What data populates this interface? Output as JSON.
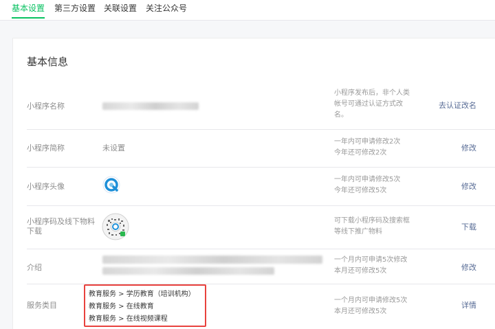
{
  "nav": {
    "tabs": [
      "基本设置",
      "第三方设置",
      "关联设置",
      "关注公众号"
    ],
    "active_index": 0
  },
  "section_title": "基本信息",
  "rows": {
    "name": {
      "label": "小程序名称",
      "note": [
        "小程序发布后，非个人类",
        "帐号可通过认证方式改",
        "名。"
      ],
      "action": "去认证改名"
    },
    "short_name": {
      "label": "小程序简称",
      "value": "未设置",
      "note": [
        "一年内可申请修改2次",
        "今年还可修改2次"
      ],
      "action": "修改"
    },
    "avatar": {
      "label": "小程序头像",
      "note": [
        "一年内可申请修改5次",
        "今年还可修改5次"
      ],
      "action": "修改"
    },
    "qrcode": {
      "label": [
        "小程序码及线下物料",
        "下载"
      ],
      "note": [
        "可下载小程序码及搜索框",
        "等线下推广物料"
      ],
      "action": "下载"
    },
    "intro": {
      "label": "介绍",
      "note": [
        "一个月内可申请5次修改",
        "本月还可修改5次"
      ],
      "action": "修改"
    },
    "category": {
      "label": "服务类目",
      "items": [
        "教育服务 > 学历教育（培训机构）",
        "教育服务 > 在线教育",
        "教育服务 > 在线视频课程"
      ],
      "note": [
        "一个月内可申请修改5次",
        "本月还可修改5次"
      ],
      "action": "详情"
    }
  },
  "colors": {
    "accent": "#07c160",
    "link": "#576b95",
    "highlight_box": "#e8413d"
  }
}
